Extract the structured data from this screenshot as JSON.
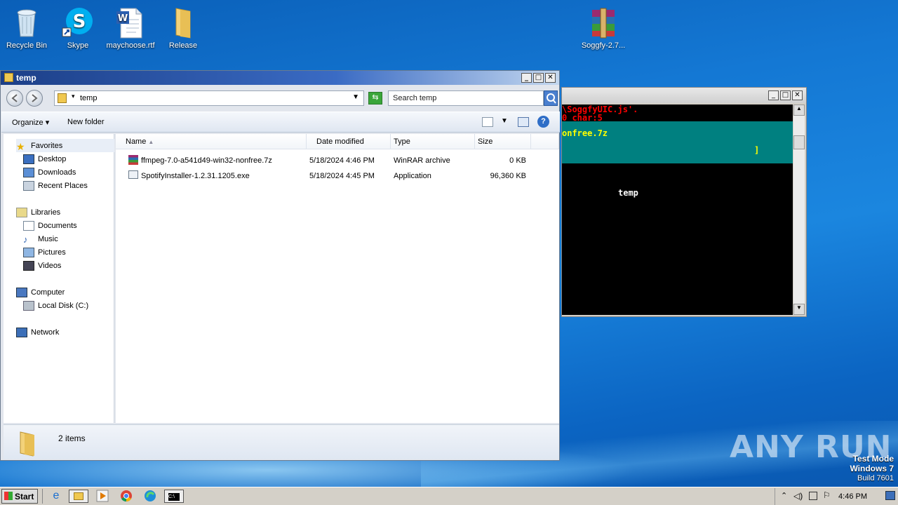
{
  "desktop": {
    "icons": [
      {
        "label": "Recycle Bin"
      },
      {
        "label": "Skype"
      },
      {
        "label": "maychoose.rtf"
      },
      {
        "label": "Release"
      },
      {
        "label": "Soggfy-2.7..."
      }
    ],
    "watermark": "ANY RUN",
    "testmode": {
      "line1": "Test Mode",
      "line2": "Windows 7",
      "line3": "Build 7601"
    }
  },
  "console": {
    "line1": "\\SoggfyUIC.js'.",
    "line2": "0 char:5",
    "line3": "onfree.7z",
    "line4": "]",
    "line5": "temp"
  },
  "explorer": {
    "title": "temp",
    "address": "temp",
    "search_placeholder": "Search temp",
    "toolbar": {
      "organize": "Organize",
      "new_folder": "New folder"
    },
    "nav": {
      "favorites": "Favorites",
      "desktop": "Desktop",
      "downloads": "Downloads",
      "recent": "Recent Places",
      "libraries": "Libraries",
      "documents": "Documents",
      "music": "Music",
      "pictures": "Pictures",
      "videos": "Videos",
      "computer": "Computer",
      "localdisk": "Local Disk (C:)",
      "network": "Network"
    },
    "columns": {
      "name": "Name",
      "date": "Date modified",
      "type": "Type",
      "size": "Size"
    },
    "files": [
      {
        "name": "ffmpeg-7.0-a541d49-win32-nonfree.7z",
        "date": "5/18/2024 4:46 PM",
        "type": "WinRAR archive",
        "size": "0 KB"
      },
      {
        "name": "SpotifyInstaller-1.2.31.1205.exe",
        "date": "5/18/2024 4:45 PM",
        "type": "Application",
        "size": "96,360 KB"
      }
    ],
    "status": "2 items"
  },
  "taskbar": {
    "start": "Start",
    "clock": "4:46 PM"
  }
}
